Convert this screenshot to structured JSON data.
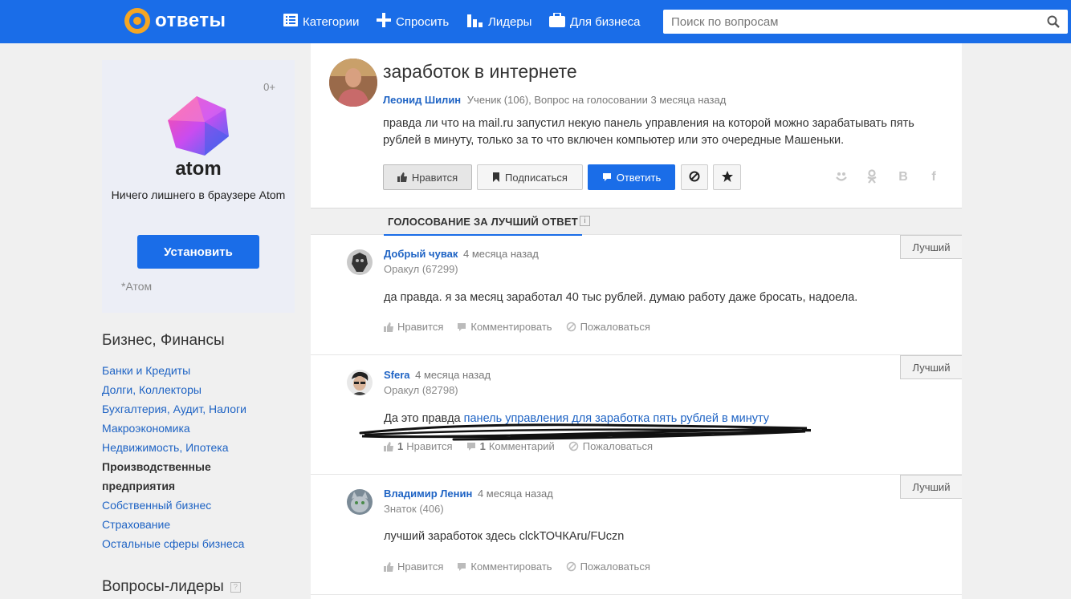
{
  "header": {
    "logo_text": "ответы",
    "nav": [
      {
        "label": "Категории",
        "icon": "list-icon"
      },
      {
        "label": "Спросить",
        "icon": "plus-icon"
      },
      {
        "label": "Лидеры",
        "icon": "bar-chart-icon"
      },
      {
        "label": "Для бизнеса",
        "icon": "briefcase-icon"
      }
    ],
    "search_placeholder": "Поиск по вопросам",
    "accent": "#1a6de8",
    "logo_color": "#f5a623"
  },
  "ad": {
    "age": "0+",
    "name": "atom",
    "text": "Ничего лишнего в браузере Atom",
    "button": "Установить",
    "source": "*Атом"
  },
  "categories": {
    "title": "Бизнес, Финансы",
    "items": [
      {
        "label": "Банки и Кредиты",
        "active": false
      },
      {
        "label": "Долги, Коллекторы",
        "active": false
      },
      {
        "label": "Бухгалтерия, Аудит, Налоги",
        "active": false
      },
      {
        "label": "Макроэкономика",
        "active": false
      },
      {
        "label": "Недвижимость, Ипотека",
        "active": false
      },
      {
        "label": "Производственные предприятия",
        "active": true
      },
      {
        "label": "Собственный бизнес",
        "active": false
      },
      {
        "label": "Страхование",
        "active": false
      },
      {
        "label": "Остальные сферы бизнеса",
        "active": false
      }
    ],
    "leaders_title": "Вопросы-лидеры"
  },
  "question": {
    "title": "заработок в интернете",
    "author": "Леонид Шилин",
    "meta": "Ученик (106), Вопрос на голосовании 3 месяца назад",
    "body": "правда ли что на mail.ru запустил некую панель управления на которой можно зарабатывать пять рублей в минуту, только за то что включен компьютер или это очередные Машеньки.",
    "actions": {
      "like": "Нравится",
      "subscribe": "Подписаться",
      "answer": "Ответить"
    },
    "share_icons": [
      "moi-mir-icon",
      "odnoklassniki-icon",
      "vk-icon",
      "facebook-icon"
    ]
  },
  "vote_tab": "ГОЛОСОВАНИЕ ЗА ЛУЧШИЙ ОТВЕТ",
  "best_label": "Лучший",
  "answers": [
    {
      "author": "Добрый чувак",
      "time": "4 месяца назад",
      "rank": "Оракул (67299)",
      "text": "да правда. я за месяц заработал 40 тыс рублей. думаю работу даже бросать, надоела.",
      "link": "",
      "likes": "",
      "like_label": "Нравится",
      "comments": "",
      "comment_label": "Комментировать",
      "report_label": "Пожаловаться"
    },
    {
      "author": "Sfera",
      "time": "4 месяца назад",
      "rank": "Оракул (82798)",
      "text": "Да это правда ",
      "link": "панель управления для заработка пять рублей в минуту",
      "likes": "1",
      "like_label": "Нравится",
      "comments": "1",
      "comment_label": "Комментарий",
      "report_label": "Пожаловаться"
    },
    {
      "author": "Владимир Ленин",
      "time": "4 месяца назад",
      "rank": "Знаток (406)",
      "text": "лучший заработок здесь clckТОЧКАru/FUczn",
      "link": "",
      "likes": "",
      "like_label": "Нравится",
      "comments": "",
      "comment_label": "Комментировать",
      "report_label": "Пожаловаться"
    }
  ]
}
